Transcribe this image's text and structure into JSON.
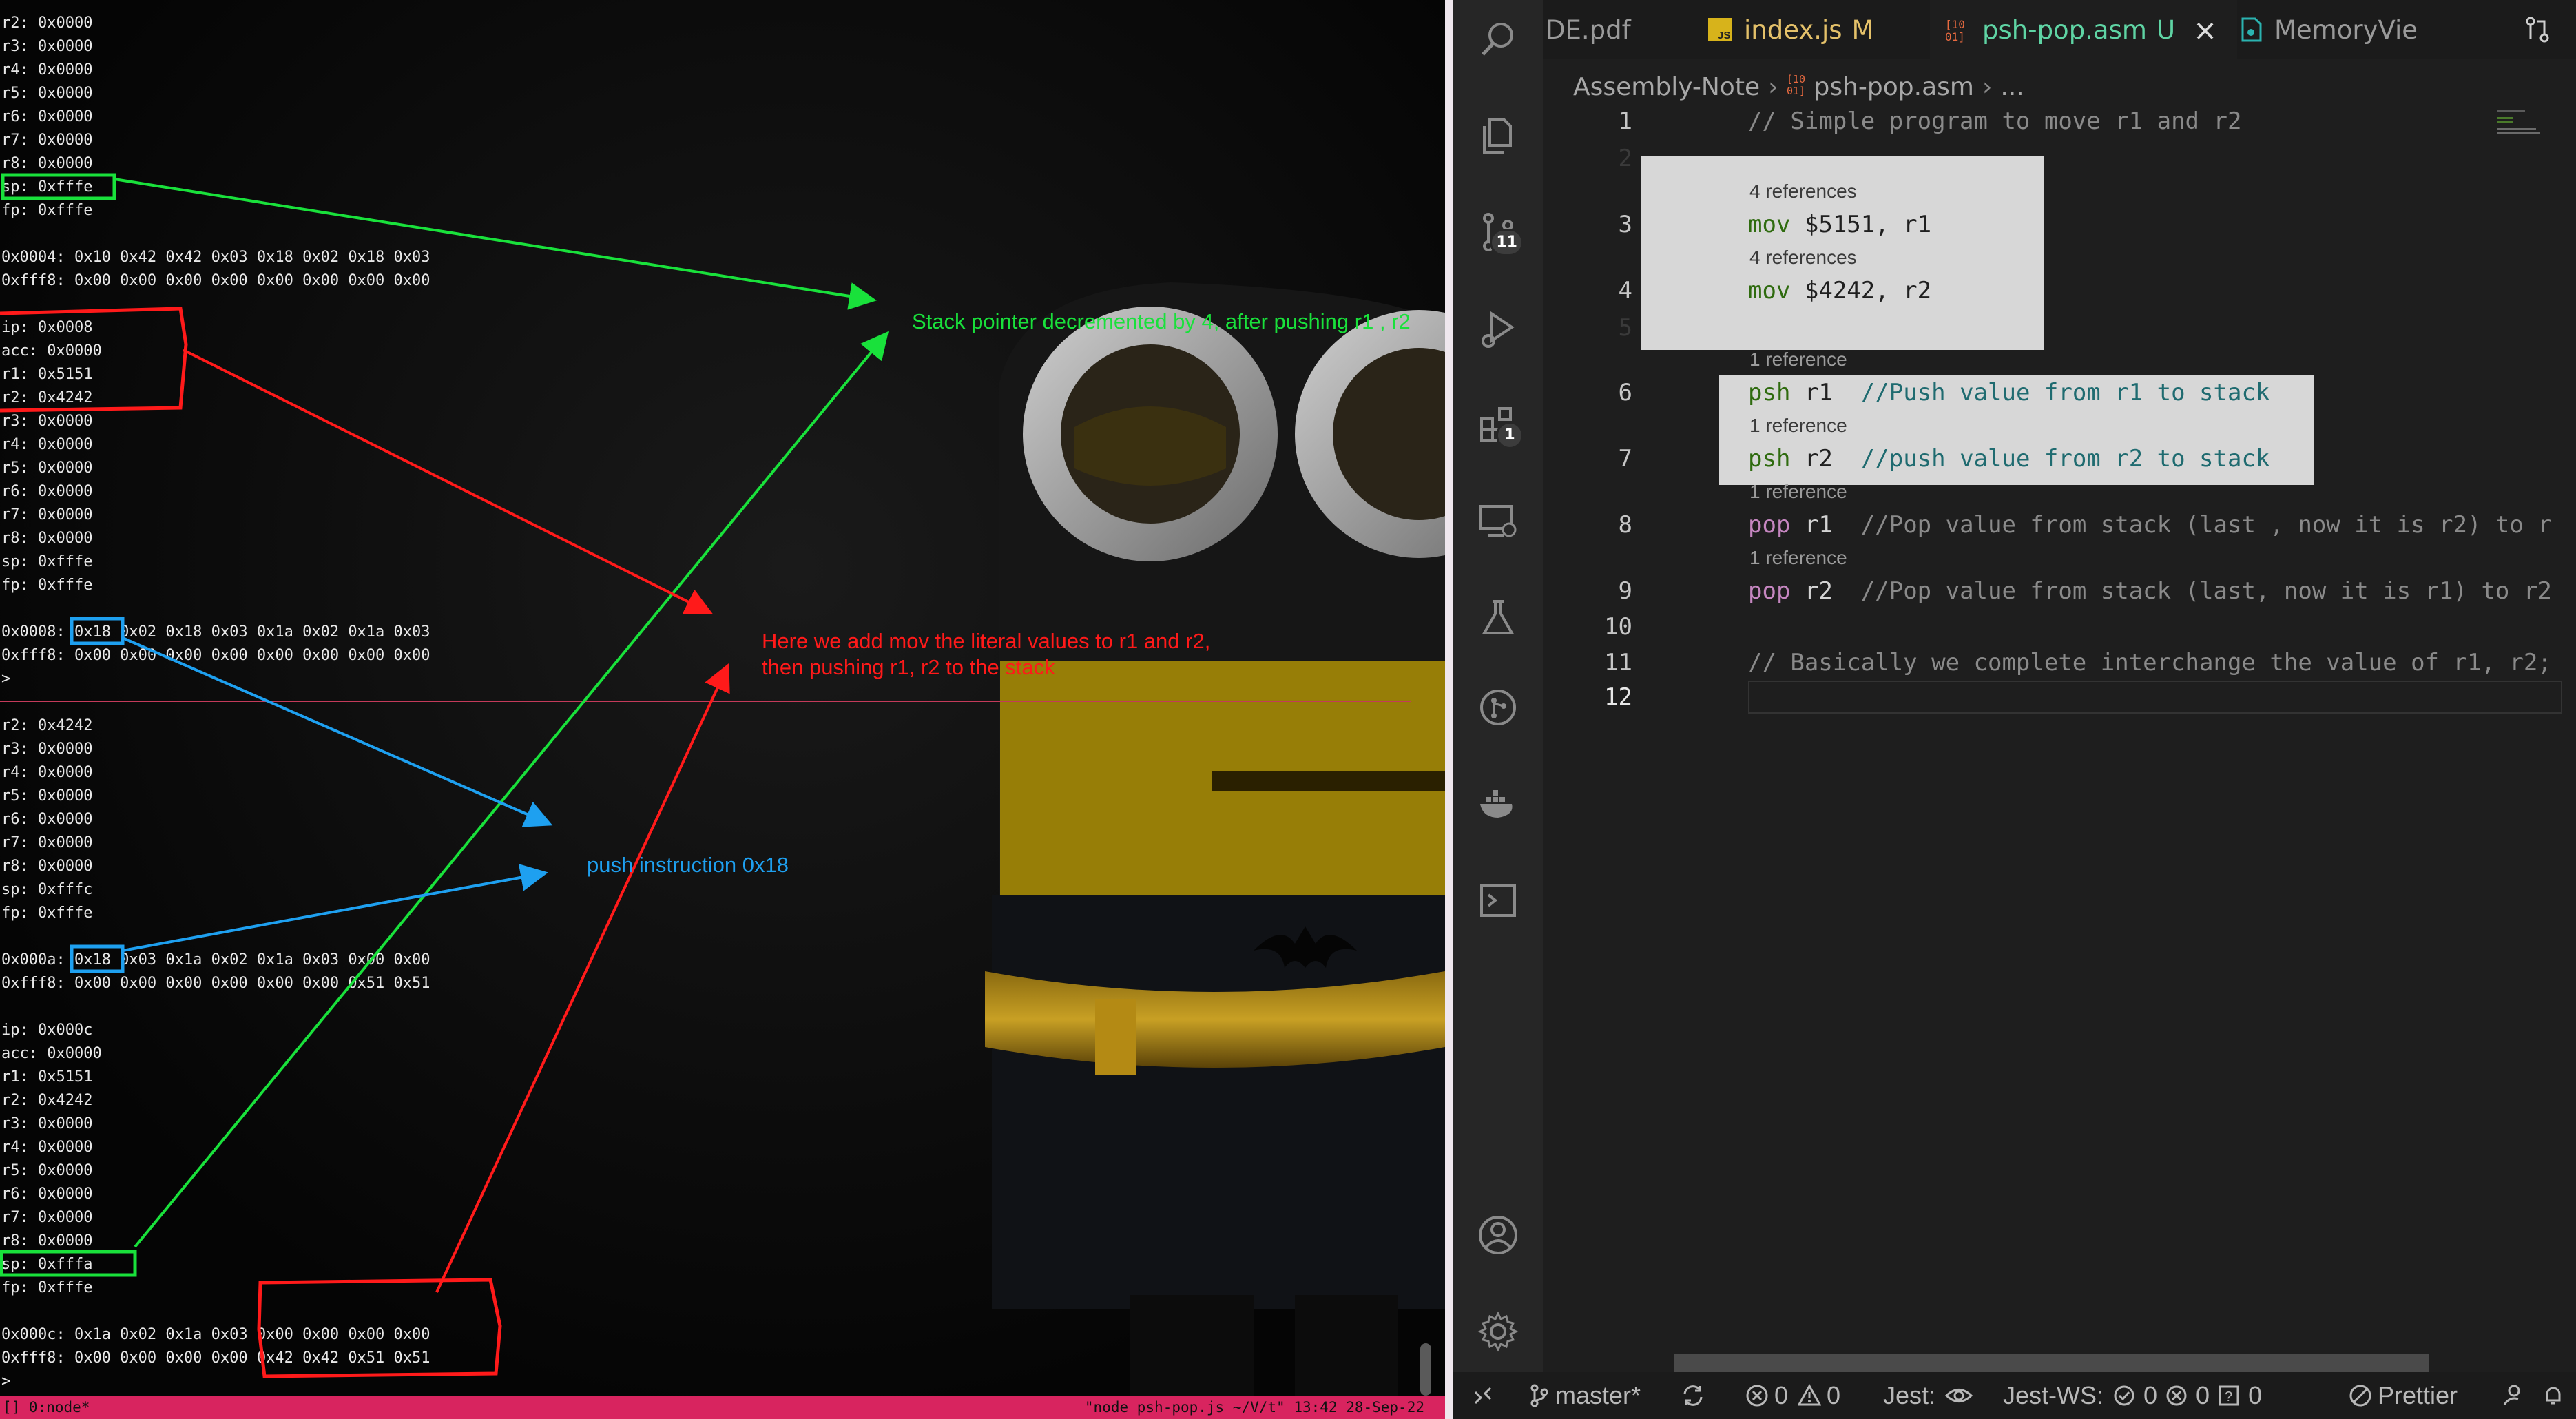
{
  "terminal": {
    "lines": [
      "r2: 0x0000",
      "r3: 0x0000",
      "r4: 0x0000",
      "r5: 0x0000",
      "r6: 0x0000",
      "r7: 0x0000",
      "r8: 0x0000",
      "sp: 0xfffe",
      "fp: 0xfffe",
      "",
      "0x0004: 0x10 0x42 0x42 0x03 0x18 0x02 0x18 0x03",
      "0xfff8: 0x00 0x00 0x00 0x00 0x00 0x00 0x00 0x00",
      "",
      "ip: 0x0008",
      "acc: 0x0000",
      "r1: 0x5151",
      "r2: 0x4242",
      "r3: 0x0000",
      "r4: 0x0000",
      "r5: 0x0000",
      "r6: 0x0000",
      "r7: 0x0000",
      "r8: 0x0000",
      "sp: 0xfffe",
      "fp: 0xfffe",
      "",
      "0x0008: 0x18 0x02 0x18 0x03 0x1a 0x02 0x1a 0x03",
      "0xfff8: 0x00 0x00 0x00 0x00 0x00 0x00 0x00 0x00",
      "> ",
      "",
      "r2: 0x4242",
      "r3: 0x0000",
      "r4: 0x0000",
      "r5: 0x0000",
      "r6: 0x0000",
      "r7: 0x0000",
      "r8: 0x0000",
      "sp: 0xfffc",
      "fp: 0xfffe",
      "",
      "0x000a: 0x18 0x03 0x1a 0x02 0x1a 0x03 0x00 0x00",
      "0xfff8: 0x00 0x00 0x00 0x00 0x00 0x00 0x51 0x51",
      "",
      "ip: 0x000c",
      "acc: 0x0000",
      "r1: 0x5151",
      "r2: 0x4242",
      "r3: 0x0000",
      "r4: 0x0000",
      "r5: 0x0000",
      "r6: 0x0000",
      "r7: 0x0000",
      "r8: 0x0000",
      "sp: 0xfffa",
      "fp: 0xfffe",
      "",
      "0x000c: 0x1a 0x02 0x1a 0x03 0x00 0x00 0x00 0x00",
      "0xfff8: 0x00 0x00 0x00 0x00 0x42 0x42 0x51 0x51",
      ">"
    ],
    "tmux_left": "[] 0:node*",
    "tmux_right": "\"node psh-pop.js ~/V/t\" 13:42 28-Sep-22"
  },
  "annotations": {
    "green_text": "Stack pointer decremented by 4, after pushing r1 , r2",
    "red_text_line1": "Here we add mov the literal values to r1 and r2,",
    "red_text_line2": "then pushing r1, r2 to the stack",
    "blue_text": "push instruction 0x18",
    "colors": {
      "green": "#19e13b",
      "red": "#ff1a1a",
      "blue": "#1ea0f0"
    }
  },
  "vscode": {
    "tabs": [
      {
        "label": "DE.pdf",
        "icon": "pdf-icon",
        "suffix": ""
      },
      {
        "label": "index.js",
        "icon": "js-file-icon",
        "suffix": "M"
      },
      {
        "label": "psh-pop.asm",
        "icon": "asm-file-icon",
        "suffix": "U"
      },
      {
        "label": "MemoryVie",
        "icon": "ts-file-icon",
        "suffix": ""
      }
    ],
    "tab_close_glyph": "×",
    "breadcrumb": {
      "folder": "Assembly-Note",
      "file": "psh-pop.asm",
      "more": "..."
    },
    "activity_badges": {
      "source_control": "11",
      "extensions": "1"
    },
    "code": [
      {
        "n": "1",
        "text": "// Simple program to move r1 and r2"
      },
      {
        "n": "2",
        "text": ""
      },
      {
        "n": "3",
        "kw": "mov",
        "rest": " $5151, r1"
      },
      {
        "n": "4",
        "kw": "mov",
        "rest": " $4242, r2"
      },
      {
        "n": "5",
        "text": ""
      },
      {
        "n": "6",
        "kw": "psh",
        "rest": " r1  ",
        "comment": "//Push value from r1 to stack"
      },
      {
        "n": "7",
        "kw": "psh",
        "rest": " r2  ",
        "comment": "//push value from r2 to stack"
      },
      {
        "n": "8",
        "kw": "pop",
        "rest": " r1  ",
        "comment": "//Pop value from stack (last , now it is r2) to r"
      },
      {
        "n": "9",
        "kw": "pop",
        "rest": " r2  ",
        "comment": "//Pop value from stack (last, now it is r1) to r2"
      },
      {
        "n": "10",
        "text": ""
      },
      {
        "n": "11",
        "text": "// Basically we complete interchange the value of r1, r2;"
      },
      {
        "n": "12",
        "text": ""
      }
    ],
    "codelens": {
      "four_refs": "4 references",
      "one_ref": "1 reference"
    },
    "status": {
      "branch": "master*",
      "errors": "0",
      "warnings": "0",
      "jest": "Jest:",
      "jest_ws": "Jest-WS:",
      "jest_ws_pass": "0",
      "jest_ws_fail": "0",
      "jest_ws_unknown": "0",
      "prettier": "Prettier"
    }
  }
}
